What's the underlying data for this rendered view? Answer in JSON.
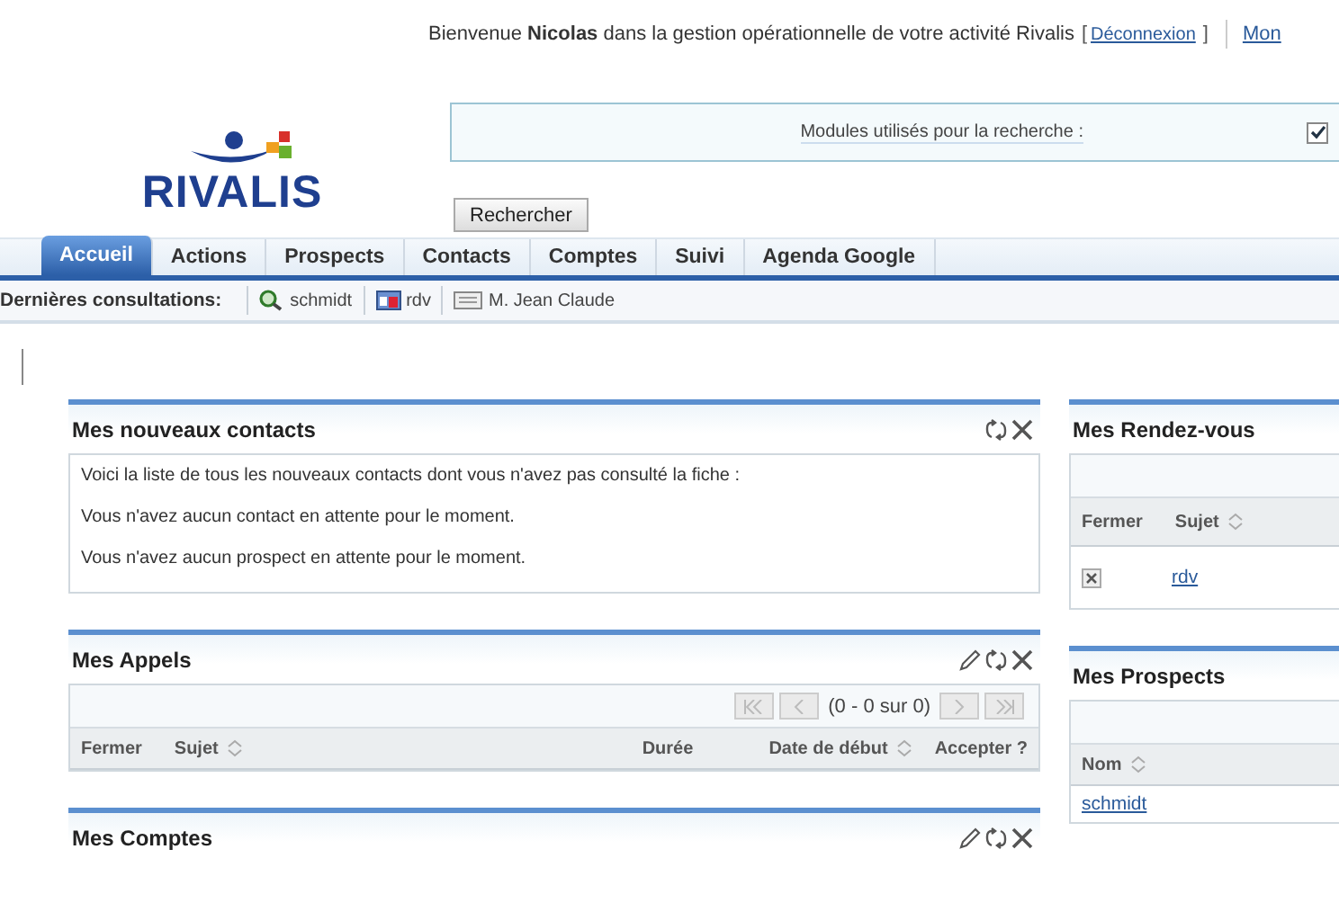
{
  "header": {
    "greeting": "Bienvenue **Nicolas** dans la gestion opérationnelle de votre activité Rivalis",
    "bracket_open": "[",
    "logout": "Déconnexion",
    "bracket_close": "]",
    "next_link": "Mon"
  },
  "logo": {
    "text": "RIVALIS"
  },
  "search": {
    "label": "Modules utilisés pour la recherche :",
    "checked": true,
    "button": "Rechercher"
  },
  "tabs": [
    {
      "label": "Accueil",
      "selected": true
    },
    {
      "label": "Actions",
      "selected": false
    },
    {
      "label": "Prospects",
      "selected": false
    },
    {
      "label": "Contacts",
      "selected": false
    },
    {
      "label": "Comptes",
      "selected": false
    },
    {
      "label": "Suivi",
      "selected": false
    },
    {
      "label": "Agenda Google",
      "selected": false
    }
  ],
  "recent": {
    "label": "Dernières consultations:",
    "items": [
      {
        "kind": "search",
        "label": "schmidt"
      },
      {
        "kind": "calendar",
        "label": "rdv"
      },
      {
        "kind": "card",
        "label": "M. Jean Claude"
      }
    ]
  },
  "left_panels": [
    {
      "title": "Mes nouveaux contacts",
      "kind": "messages",
      "tools": [
        {
          "kind": "refresh"
        },
        {
          "kind": "close"
        }
      ],
      "lines": [
        "Voici la liste de tous les nouveaux contacts dont vous n'avez pas consulté la fiche :",
        "Vous n'avez aucun contact en attente pour le moment.",
        "Vous n'avez aucun prospect en attente pour le moment."
      ]
    },
    {
      "title": "Mes Appels",
      "kind": "grid",
      "tools": [
        {
          "kind": "edit"
        },
        {
          "kind": "refresh"
        },
        {
          "kind": "close"
        }
      ],
      "pager": "(0 - 0 sur 0)",
      "columns": [
        {
          "label": "Fermer",
          "sortable": false
        },
        {
          "label": "Sujet",
          "sortable": true
        },
        {
          "label": "Durée",
          "sortable": false
        },
        {
          "label": "Date de début",
          "sortable": true
        },
        {
          "label": "Accepter ?",
          "sortable": false
        }
      ]
    },
    {
      "title": "Mes Comptes",
      "kind": "collapsed",
      "tools": [
        {
          "kind": "edit"
        },
        {
          "kind": "refresh"
        },
        {
          "kind": "close"
        }
      ]
    }
  ],
  "right_panels": [
    {
      "title": "Mes Rendez-vous",
      "kind": "grid",
      "columns": [
        {
          "label": "Fermer",
          "sortable": false
        },
        {
          "label": "Sujet",
          "sortable": true
        }
      ],
      "rows": [
        [
          {
            "kind": "remove"
          },
          {
            "kind": "link",
            "text": "rdv"
          }
        ]
      ]
    },
    {
      "title": "Mes Prospects",
      "kind": "grid",
      "columns": [
        {
          "label": "Nom",
          "sortable": true
        }
      ],
      "rows": [
        [
          {
            "kind": "link",
            "text": "schmidt"
          }
        ]
      ]
    }
  ]
}
